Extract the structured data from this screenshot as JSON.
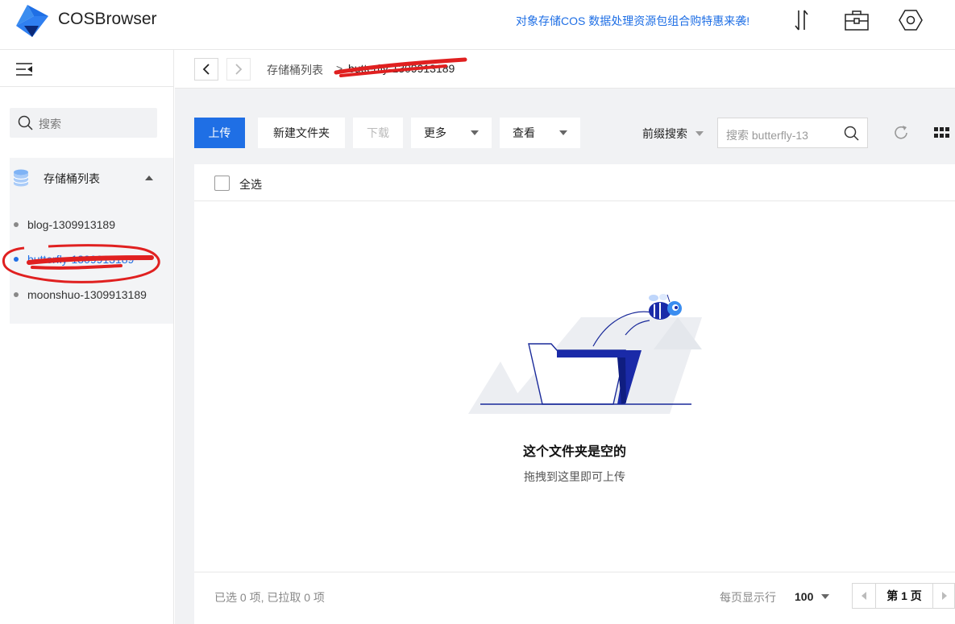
{
  "header": {
    "app_title": "COSBrowser",
    "promo": "对象存储COS 数据处理资源包组合购特惠来袭!",
    "icons": [
      "transfer-icon",
      "toolbox-icon",
      "settings-icon"
    ]
  },
  "sidebar": {
    "search_placeholder": "搜索",
    "bucket_section_label": "存储桶列表",
    "buckets": [
      {
        "name": "blog-1309913189",
        "active": false
      },
      {
        "name": "butterfly-1309913189",
        "active": true
      },
      {
        "name": "moonshuo-1309913189",
        "active": false
      }
    ]
  },
  "breadcrumb": {
    "root": "存储桶列表",
    "separator": ">",
    "current": "butterfly-1309913189"
  },
  "toolbar": {
    "upload": "上传",
    "new_folder": "新建文件夹",
    "download": "下载",
    "more": "更多",
    "view": "查看",
    "search_mode": "前缀搜索",
    "search_placeholder": "搜索 butterfly-13"
  },
  "list": {
    "select_all": "全选",
    "empty_title": "这个文件夹是空的",
    "empty_subtitle": "拖拽到这里即可上传"
  },
  "footer": {
    "status": "已选 0 项, 已拉取 0 项",
    "per_page_label": "每页显示行",
    "per_page_value": "100",
    "page_label": "第 1 页"
  },
  "colors": {
    "accent": "#1f6fe5",
    "annotation_red": "#e02020"
  }
}
